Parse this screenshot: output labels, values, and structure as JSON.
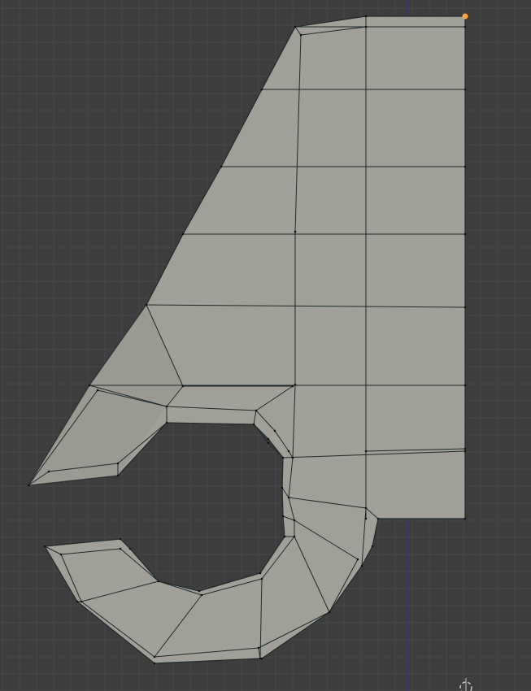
{
  "viewport": {
    "kind": "3d-viewport-orthographic",
    "mode": "edit-mode-mesh",
    "colors": {
      "background": "#3d3d3d",
      "grid_minor": "#464646",
      "grid_major": "#4a4a4a",
      "axis_z": "#33338a",
      "mesh_face": "#a09f98",
      "mesh_face_shade": "#8f8e88",
      "mesh_edge": "#1f2a2a",
      "selected_vertex": "#ffa53a",
      "origin_marker": "#c8c8c8"
    }
  },
  "mesh": {
    "name": "",
    "selected_vertex_count": 1
  }
}
